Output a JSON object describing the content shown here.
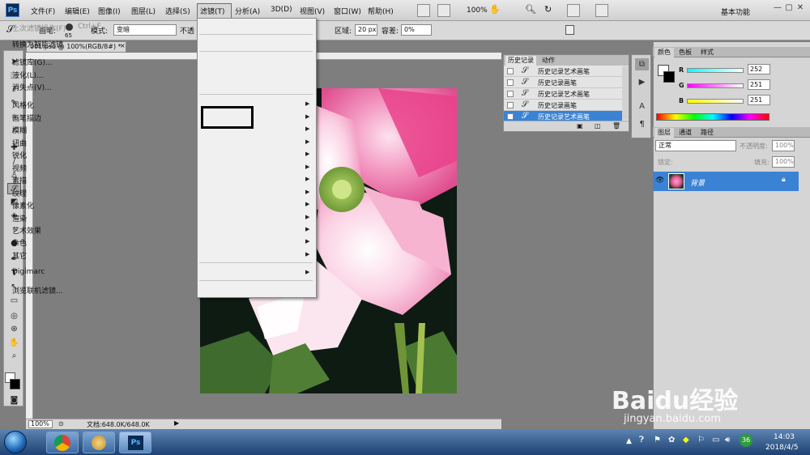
{
  "app": {
    "logo": "Ps",
    "menu": [
      "文件(F)",
      "编辑(E)",
      "图像(I)",
      "图层(L)",
      "选择(S)",
      "滤镜(T)",
      "分析(A)",
      "3D(D)",
      "视图(V)",
      "窗口(W)",
      "帮助(H)"
    ],
    "zoom": "100%",
    "workspace": "基本功能",
    "window_buttons": [
      "—",
      "▢",
      "✕"
    ]
  },
  "options_bar": {
    "brush_label": "画笔:",
    "brush_size": "65",
    "mode_label": "模式:",
    "mode_value": "变暗",
    "opacity_label": "不透",
    "area_label": "区域:",
    "area_value": "20 px",
    "tolerance_label": "容差:",
    "tolerance_value": "0%"
  },
  "document": {
    "tab_title": "001.psd @ 100%(RGB/8#) *",
    "status_zoom": "100%",
    "status_info": "文档:648.0K/648.0K"
  },
  "filter_menu": {
    "items": [
      {
        "label": "上次滤镜操作(F)",
        "shortcut": "Ctrl+F",
        "disabled": true
      },
      {
        "label": "转换为智能滤镜"
      },
      {
        "label": "滤镜库(G)..."
      },
      {
        "label": "液化(L)..."
      },
      {
        "label": "消失点(V)..."
      },
      {
        "label": "风格化",
        "submenu": true
      },
      {
        "label": "画笔描边",
        "submenu": true
      },
      {
        "label": "模糊",
        "submenu": true
      },
      {
        "label": "扭曲",
        "submenu": true
      },
      {
        "label": "锐化",
        "submenu": true
      },
      {
        "label": "视频",
        "submenu": true
      },
      {
        "label": "素描",
        "submenu": true
      },
      {
        "label": "纹理",
        "submenu": true
      },
      {
        "label": "像素化",
        "submenu": true
      },
      {
        "label": "渲染",
        "submenu": true
      },
      {
        "label": "艺术效果",
        "submenu": true
      },
      {
        "label": "杂色",
        "submenu": true
      },
      {
        "label": "其它",
        "submenu": true
      },
      {
        "label": "Digimarc",
        "submenu": true
      },
      {
        "label": "浏览联机滤镜..."
      }
    ]
  },
  "history_panel": {
    "tabs": [
      "历史记录",
      "动作"
    ],
    "rows": [
      "历史记录艺术画笔",
      "历史记录画笔",
      "历史记录艺术画笔",
      "历史记录画笔",
      "历史记录艺术画笔"
    ],
    "selected_index": 4
  },
  "color_panel": {
    "tabs": [
      "颜色",
      "色板",
      "样式"
    ],
    "r_label": "R",
    "r_value": "252",
    "g_label": "G",
    "g_value": "251",
    "b_label": "B",
    "b_value": "251"
  },
  "layers_panel": {
    "tabs": [
      "图层",
      "通道",
      "路径"
    ],
    "blend_mode": "正常",
    "opacity_label": "不透明度:",
    "opacity_value": "100%",
    "lock_label": "锁定:",
    "fill_label": "填充:",
    "fill_value": "100%",
    "layer_name": "背景"
  },
  "taskbar": {
    "time": "14:03",
    "date": "2018/4/5",
    "tray_badge": "36"
  },
  "watermark": {
    "logo": "Baidu经验",
    "url": "jingyan.baidu.com"
  }
}
